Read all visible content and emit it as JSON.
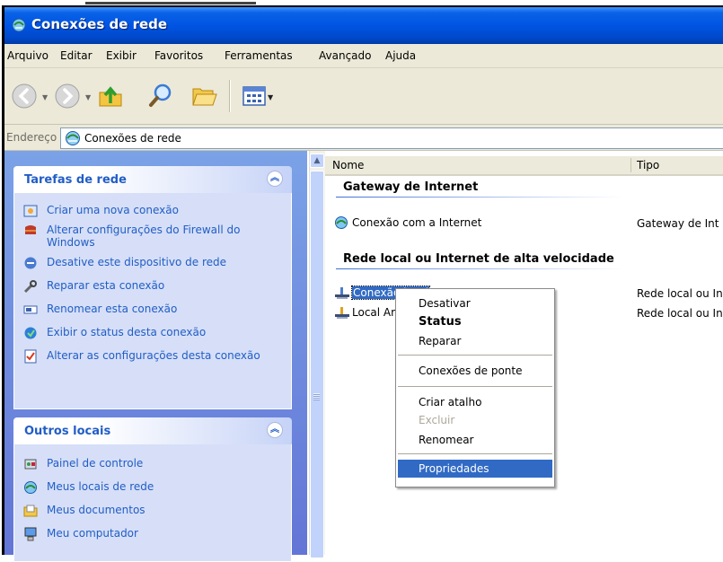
{
  "window": {
    "title": "Conexões de rede"
  },
  "menubar": {
    "items": [
      "Arquivo",
      "Editar",
      "Exibir",
      "Favoritos",
      "Ferramentas",
      "Avançado",
      "Ajuda"
    ]
  },
  "toolbar": {
    "buttons": [
      "back-icon",
      "forward-icon",
      "up-folder-icon",
      "search-icon",
      "folders-icon",
      "views-icon"
    ]
  },
  "address": {
    "label": "Endereço",
    "value": "Conexões de rede"
  },
  "tasks_panel": {
    "title": "Tarefas de rede",
    "items": [
      "Criar uma nova conexão",
      "Alterar configurações do Firewall do Windows",
      "Desative este dispositivo de rede",
      "Reparar esta conexão",
      "Renomear esta conexão",
      "Exibir o status desta conexão",
      "Alterar as configurações desta conexão"
    ]
  },
  "other_places_panel": {
    "title": "Outros locais",
    "items": [
      "Painel de controle",
      "Meus locais de rede",
      "Meus documentos",
      "Meu computador"
    ]
  },
  "list": {
    "columns": [
      "Nome",
      "Tipo"
    ],
    "groups": [
      {
        "title": "Gateway de Internet",
        "items": [
          {
            "name": "Conexão com a Internet",
            "type": "Gateway de Int"
          }
        ]
      },
      {
        "title": "Rede local ou Internet de alta velocidade",
        "items": [
          {
            "name": "Conexão local",
            "type": "Rede local ou In",
            "selected": true
          },
          {
            "name": "Local Are",
            "type": "Rede local ou In"
          }
        ]
      }
    ]
  },
  "context_menu": {
    "items": {
      "disable": "Desativar",
      "status": "Status",
      "repair": "Reparar",
      "bridge": "Conexões de ponte",
      "shortcut": "Criar atalho",
      "delete": "Excluir",
      "rename": "Renomear",
      "properties": "Propriedades"
    },
    "highlighted": "Propriedades"
  },
  "colors": {
    "titlebar": "#0054e3",
    "taskpane": "#6f8ddf",
    "link": "#215dc6",
    "selection": "#316ac5"
  }
}
